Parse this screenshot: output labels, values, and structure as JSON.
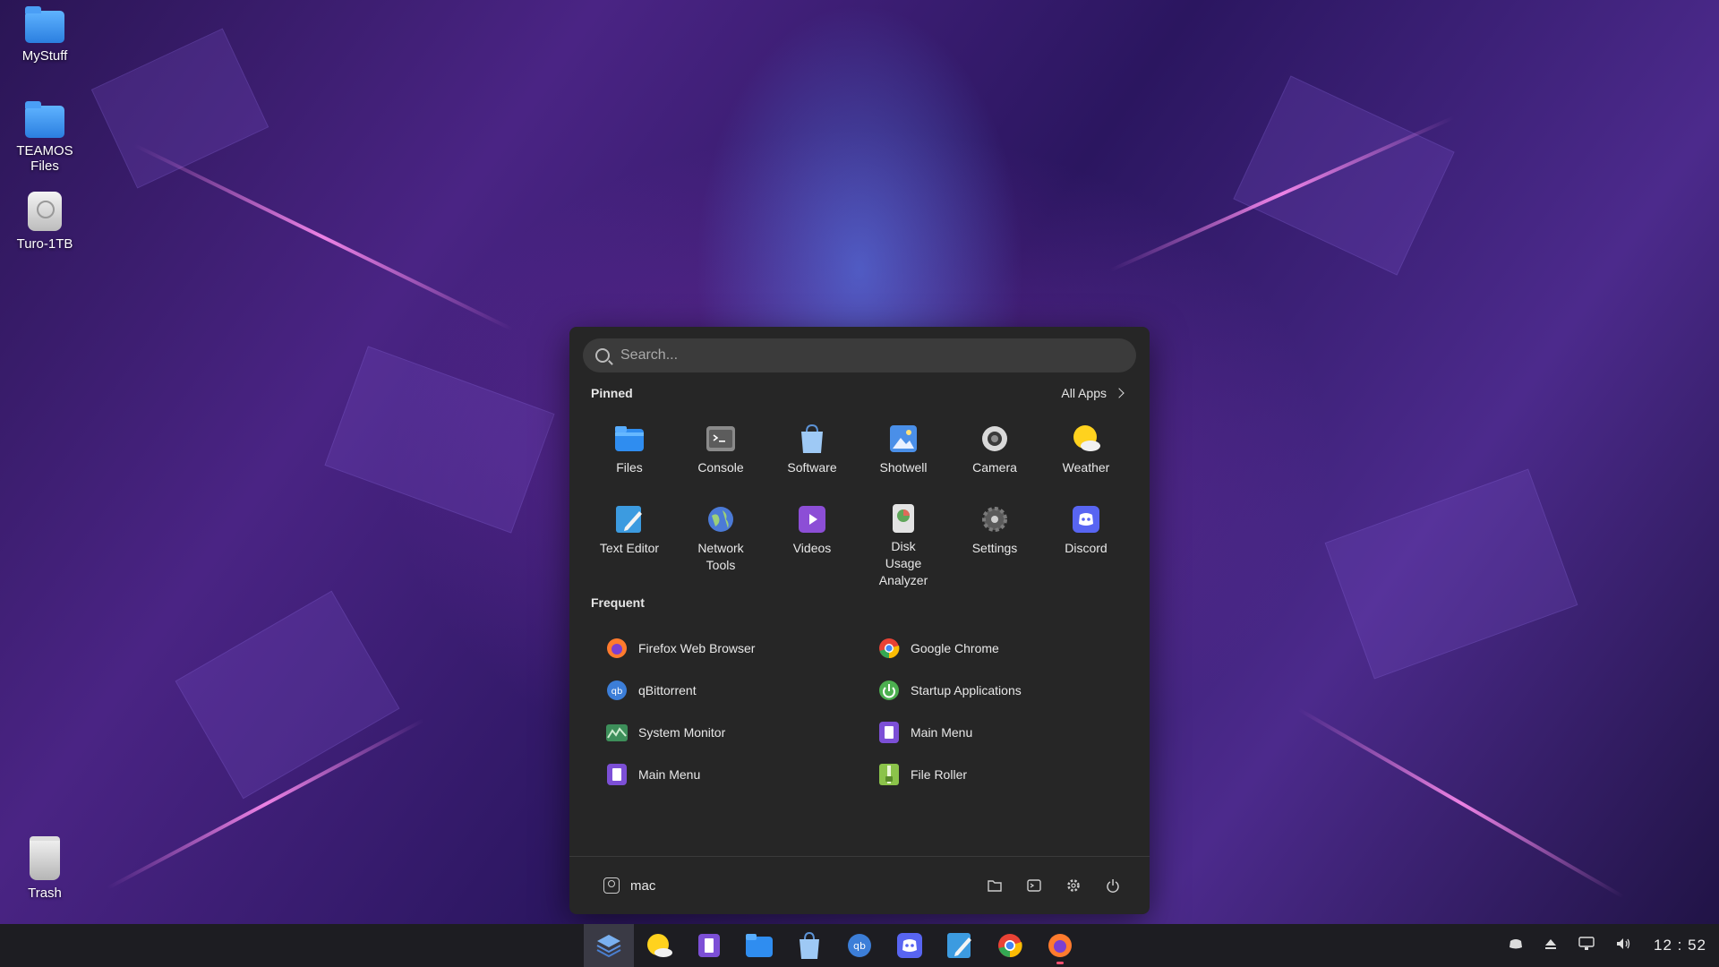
{
  "desktop": {
    "icons": [
      {
        "label": "MyStuff",
        "icon": "folder-icon"
      },
      {
        "label": "TEAMOS Files",
        "icon": "folder-icon"
      },
      {
        "label": "Turo-1TB",
        "icon": "drive-icon"
      },
      {
        "label": "Trash",
        "icon": "trash-icon"
      }
    ]
  },
  "menu": {
    "search_placeholder": "Search...",
    "pinned_title": "Pinned",
    "all_apps_label": "All Apps",
    "pinned": [
      {
        "label": "Files",
        "icon": "files-icon"
      },
      {
        "label": "Console",
        "icon": "console-icon"
      },
      {
        "label": "Software",
        "icon": "software-icon"
      },
      {
        "label": "Shotwell",
        "icon": "shotwell-icon"
      },
      {
        "label": "Camera",
        "icon": "camera-icon"
      },
      {
        "label": "Weather",
        "icon": "weather-icon"
      },
      {
        "label": "Text Editor",
        "icon": "text-editor-icon"
      },
      {
        "label": "Network Tools",
        "icon": "network-tools-icon"
      },
      {
        "label": "Videos",
        "icon": "videos-icon"
      },
      {
        "label": "Disk Usage Analyzer",
        "icon": "disk-usage-icon"
      },
      {
        "label": "Settings",
        "icon": "settings-icon"
      },
      {
        "label": "Discord",
        "icon": "discord-icon"
      }
    ],
    "frequent_title": "Frequent",
    "frequent": [
      {
        "label": "Firefox Web Browser",
        "icon": "firefox-icon"
      },
      {
        "label": "Google Chrome",
        "icon": "chrome-icon"
      },
      {
        "label": "qBittorrent",
        "icon": "qbittorrent-icon"
      },
      {
        "label": "Startup Applications",
        "icon": "startup-icon"
      },
      {
        "label": "System Monitor",
        "icon": "system-monitor-icon"
      },
      {
        "label": "Main Menu",
        "icon": "main-menu-icon"
      },
      {
        "label": "Main Menu",
        "icon": "main-menu-icon"
      },
      {
        "label": "File Roller",
        "icon": "file-roller-icon"
      }
    ],
    "user_name": "mac"
  },
  "taskbar": {
    "apps": [
      "app-grid-icon",
      "weather-icon",
      "main-menu-icon",
      "files-icon",
      "software-icon",
      "qbittorrent-icon",
      "discord-icon",
      "text-editor-icon",
      "chrome-icon",
      "firefox-icon"
    ],
    "clock": "12 : 52"
  },
  "colors": {
    "menu_bg": "#262626",
    "taskbar_bg": "#1d1d22",
    "accent_running": "#ff5070"
  }
}
